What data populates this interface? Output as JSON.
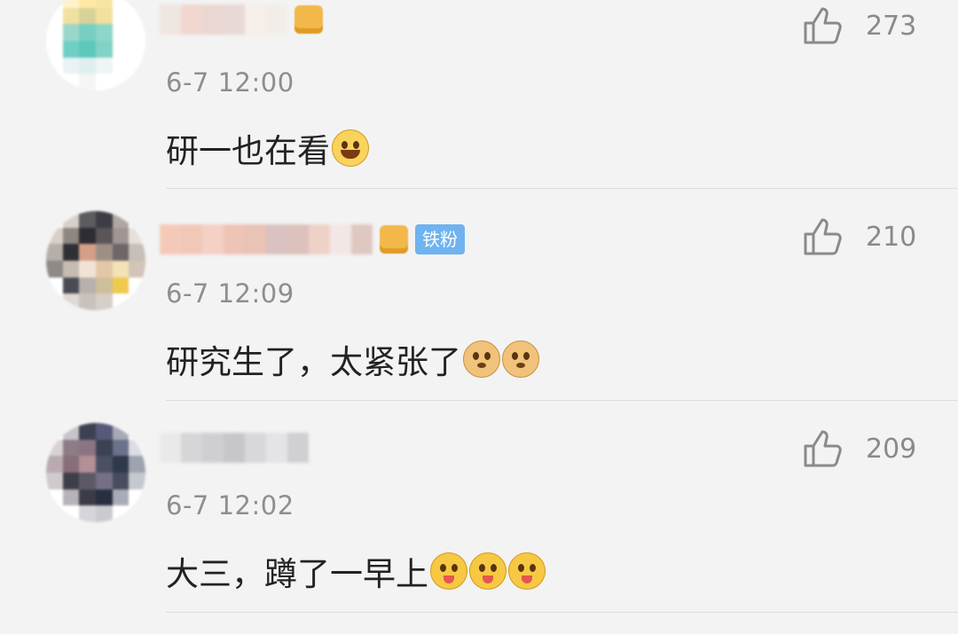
{
  "comments": [
    {
      "time": "6-7 12:00",
      "text": "研一也在看",
      "likes": "273",
      "emojis": [
        "laugh-cry-emoji"
      ],
      "fan_tag": "",
      "avatar_colors": [
        "#ffffff",
        "#fff2c8",
        "#ffe9a5",
        "#f5e6a6",
        "#ffffff",
        "#ffffff",
        "#ffffff",
        "#f0e1a0",
        "#d8d29a",
        "#f2e09c",
        "#ffffff",
        "#ffffff",
        "#ffffff",
        "#9bd7c8",
        "#77cfc4",
        "#8dd6c9",
        "#ffffff",
        "#ffffff",
        "#ffffff",
        "#6ecfc4",
        "#5ec8bb",
        "#82d2c5",
        "#ffffff",
        "#ffffff",
        "#ffffff",
        "#e9f3f3",
        "#dfefee",
        "#eef5f4",
        "#ffffff",
        "#ffffff",
        "#ffffff",
        "#ffffff",
        "#f5f5f5",
        "#ffffff",
        "#ffffff",
        "#ffffff"
      ]
    },
    {
      "time": "6-7 12:09",
      "text": "研究生了，太紧张了",
      "likes": "210",
      "emojis": [
        "doge-emoji",
        "doge-emoji"
      ],
      "fan_tag": "铁粉",
      "avatar_colors": [
        "#ffffff",
        "#d8d0c8",
        "#5b5b60",
        "#3d3d44",
        "#b0a7a0",
        "#ffffff",
        "#d9cfc6",
        "#8f8680",
        "#2d2d33",
        "#5b5558",
        "#9f9593",
        "#e6e0da",
        "#b5aea9",
        "#2f3036",
        "#d59f87",
        "#9e8f86",
        "#6d6768",
        "#c7beb8",
        "#8d8a88",
        "#c7bcb2",
        "#f0e3d6",
        "#e3c8a8",
        "#f2e2b6",
        "#d2c4b6",
        "#ffffff",
        "#4a4c55",
        "#b7b0ac",
        "#cdbf9b",
        "#f0c94f",
        "#ffffff",
        "#ffffff",
        "#e0d9d3",
        "#c9c2bc",
        "#d5cfc8",
        "#ffffff",
        "#ffffff"
      ]
    },
    {
      "time": "6-7 12:02",
      "text": "大三，蹲了一早上",
      "likes": "209",
      "emojis": [
        "tongue-emoji",
        "tongue-emoji",
        "tongue-emoji"
      ],
      "fan_tag": "",
      "avatar_colors": [
        "#ffffff",
        "#c7c4cc",
        "#3d4053",
        "#56597a",
        "#a7a9b7",
        "#ffffff",
        "#d8d2d4",
        "#8d7b86",
        "#8b7582",
        "#3c4252",
        "#6a7289",
        "#dcdde2",
        "#b9aab1",
        "#876e79",
        "#b48f96",
        "#4a4f62",
        "#30384b",
        "#9fa3b0",
        "#cfcacd",
        "#3e3e4a",
        "#5c5965",
        "#757085",
        "#474c5e",
        "#c6c8cf",
        "#ffffff",
        "#b8b3b8",
        "#3c3c49",
        "#28303f",
        "#a9acb7",
        "#ffffff",
        "#ffffff",
        "#ffffff",
        "#d6d5da",
        "#c9cbd1",
        "#ffffff",
        "#ffffff"
      ]
    }
  ]
}
